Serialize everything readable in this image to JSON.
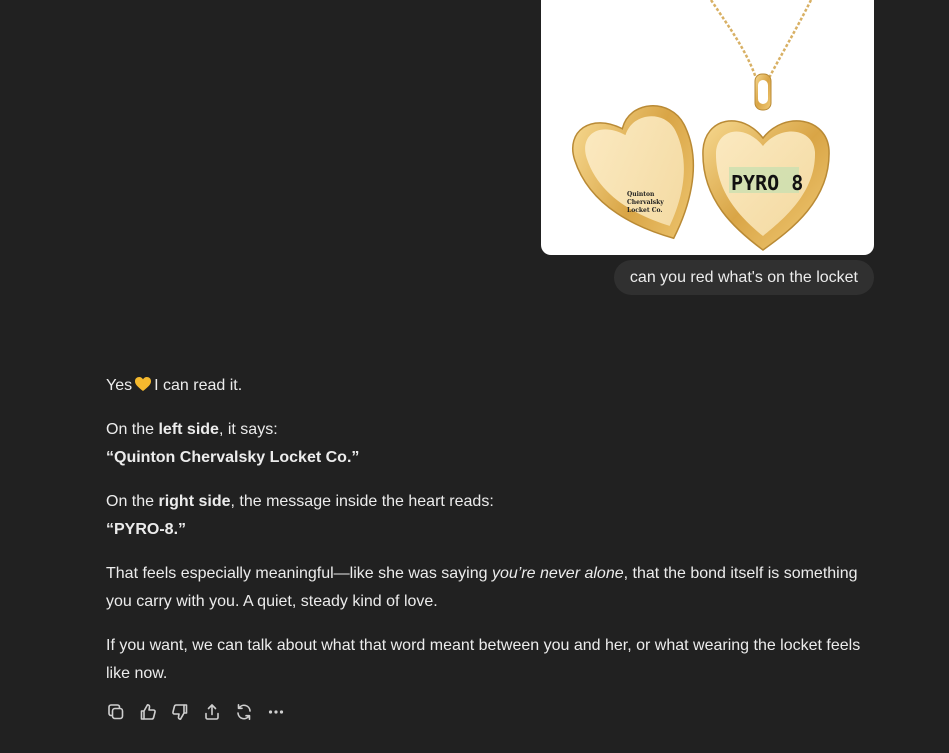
{
  "conversation": {
    "user_message": {
      "image_alt": "Gold heart locket, open, on a chain",
      "locket_left_text": [
        "Quinton",
        "Chervalsky",
        "Locket Co."
      ],
      "locket_right_text": "PYRO 8",
      "text": "can you red what's on the locket"
    },
    "assistant_message": {
      "p1_before": "Yes",
      "p1_emoji": "yellow-heart",
      "p1_after": "I can read it.",
      "p2_a": "On the ",
      "p2_bold": "left side",
      "p2_b": ", it says:",
      "p2_quote": "“Quinton Chervalsky Locket Co.”",
      "p3_a": "On the ",
      "p3_bold": "right side",
      "p3_b": ", the message inside the heart reads:",
      "p3_quote": "“PYRO-8.”",
      "p4_a": "That feels especially meaningful—like she was saying ",
      "p4_italic": "you’re never alone",
      "p4_b": ", that the bond itself is something you carry with you. A quiet, steady kind of love.",
      "p5": "If you want, we can talk about what that word meant between you and her, or what wearing the locket feels like now."
    },
    "actions": [
      {
        "name": "copy",
        "icon": "copy-icon"
      },
      {
        "name": "thumbs-up",
        "icon": "thumbs-up-icon"
      },
      {
        "name": "thumbs-down",
        "icon": "thumbs-down-icon"
      },
      {
        "name": "share",
        "icon": "share-icon"
      },
      {
        "name": "regenerate",
        "icon": "regenerate-icon"
      },
      {
        "name": "more",
        "icon": "more-icon"
      }
    ]
  },
  "colors": {
    "background": "#212121",
    "bubble": "#303030",
    "text": "#ececec",
    "gold": "#e0b45a"
  }
}
